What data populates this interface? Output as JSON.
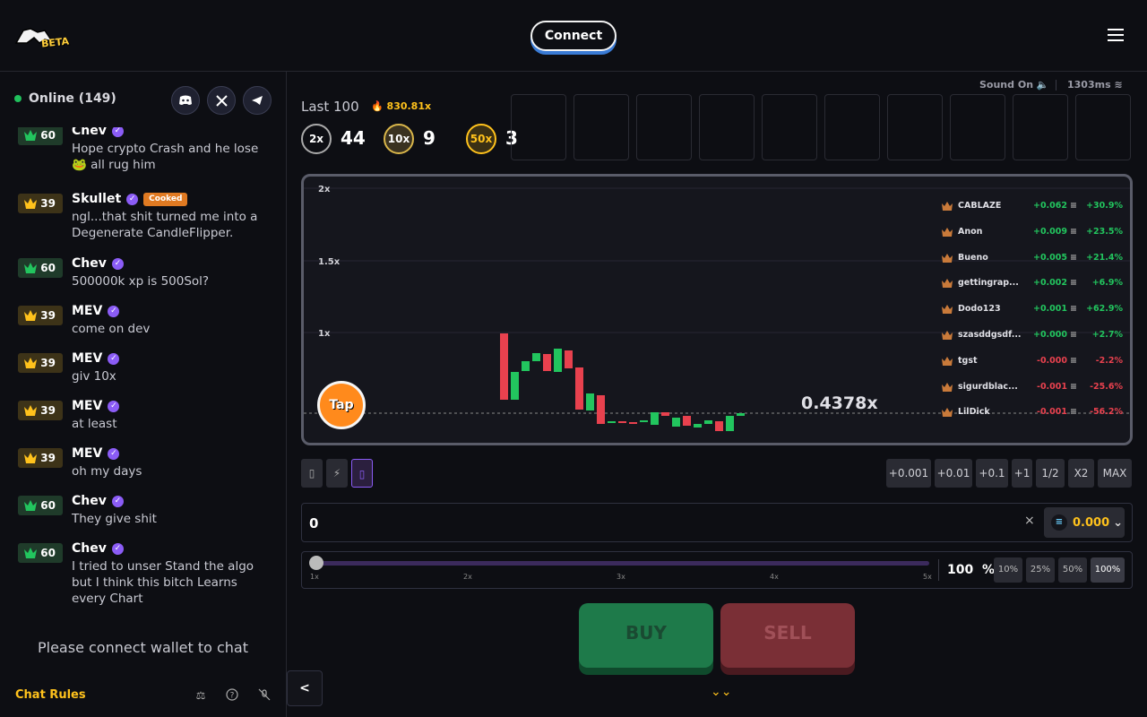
{
  "header": {
    "logo_badge": "BETA",
    "connect_label": "Connect"
  },
  "sidebar": {
    "online_label": "Online (149)",
    "social": [
      "discord-icon",
      "x-icon",
      "telegram-icon"
    ],
    "messages": [
      {
        "level": "60",
        "tier": "green",
        "user": "Chev",
        "verified": true,
        "badge": "",
        "text": "Hope crypto Crash and he lose 🐸 all rug him"
      },
      {
        "level": "39",
        "tier": "gold",
        "user": "Skullet",
        "verified": true,
        "badge": "Cooked",
        "text": "ngl...that shit turned me into a Degenerate CandleFlipper."
      },
      {
        "level": "60",
        "tier": "green",
        "user": "Chev",
        "verified": true,
        "badge": "",
        "text": "500000k xp is 500Sol?"
      },
      {
        "level": "39",
        "tier": "gold",
        "user": "MEV",
        "verified": true,
        "badge": "",
        "text": "come on dev"
      },
      {
        "level": "39",
        "tier": "gold",
        "user": "MEV",
        "verified": true,
        "badge": "",
        "text": "giv 10x"
      },
      {
        "level": "39",
        "tier": "gold",
        "user": "MEV",
        "verified": true,
        "badge": "",
        "text": "at least"
      },
      {
        "level": "39",
        "tier": "gold",
        "user": "MEV",
        "verified": true,
        "badge": "",
        "text": "oh my days"
      },
      {
        "level": "60",
        "tier": "green",
        "user": "Chev",
        "verified": true,
        "badge": "",
        "text": "They give shit"
      },
      {
        "level": "60",
        "tier": "green",
        "user": "Chev",
        "verified": true,
        "badge": "",
        "text": "I tried to unser Stand the algo but I think this bitch Learns every Chart"
      }
    ],
    "connect_prompt": "Please connect wallet to chat",
    "chat_rules": "Chat Rules",
    "footer_icons": [
      "scale-icon",
      "help-icon",
      "mute-icon"
    ],
    "collapse_label": "<"
  },
  "main": {
    "sound_label": "Sound On",
    "ping_label": "1303ms",
    "last100_label": "Last 100",
    "last100_value": "830.81x",
    "stats": [
      {
        "coin": "2x",
        "count": "44",
        "color": "#bbbbbb"
      },
      {
        "coin": "10x",
        "count": "9",
        "color": "#d9b64a"
      },
      {
        "coin": "50x",
        "count": "3",
        "color": "#ffc21c"
      }
    ],
    "history_slots": 10,
    "chart": {
      "y_labels": [
        "2x",
        "1.5x",
        "1x"
      ],
      "current_multiplier": "0.4378x",
      "tap_label": "Tap"
    },
    "leaderboard": [
      {
        "name": "CABLAZE",
        "amount": "+0.062",
        "pct": "+30.9%",
        "dir": "up"
      },
      {
        "name": "Anon",
        "amount": "+0.009",
        "pct": "+23.5%",
        "dir": "up"
      },
      {
        "name": "Bueno",
        "amount": "+0.005",
        "pct": "+21.4%",
        "dir": "up"
      },
      {
        "name": "gettingrap...",
        "amount": "+0.002",
        "pct": "+6.9%",
        "dir": "up"
      },
      {
        "name": "Dodo123",
        "amount": "+0.001",
        "pct": "+62.9%",
        "dir": "up"
      },
      {
        "name": "szasddgsdf...",
        "amount": "+0.000",
        "pct": "+2.7%",
        "dir": "up"
      },
      {
        "name": "tgst",
        "amount": "-0.000",
        "pct": "-2.2%",
        "dir": "down"
      },
      {
        "name": "sigurdblac...",
        "amount": "-0.001",
        "pct": "-25.6%",
        "dir": "down"
      },
      {
        "name": "LilDick",
        "amount": "-0.001",
        "pct": "-56.2%",
        "dir": "down"
      }
    ],
    "mode_buttons": [
      "",
      "⚡",
      ""
    ],
    "amount_buttons": [
      "+0.001",
      "+0.01",
      "+0.1",
      "+1",
      "1/2",
      "X2",
      "MAX"
    ],
    "amount_input_value": "0",
    "clear_label": "×",
    "token_balance": "0.000",
    "slider_ticks": [
      "1x",
      "2x",
      "3x",
      "4x",
      "5x"
    ],
    "slider_percent": "100",
    "percent_unit": "%",
    "percent_buttons": [
      "10%",
      "25%",
      "50%",
      "100%"
    ],
    "buy_label": "BUY",
    "sell_label": "SELL"
  }
}
